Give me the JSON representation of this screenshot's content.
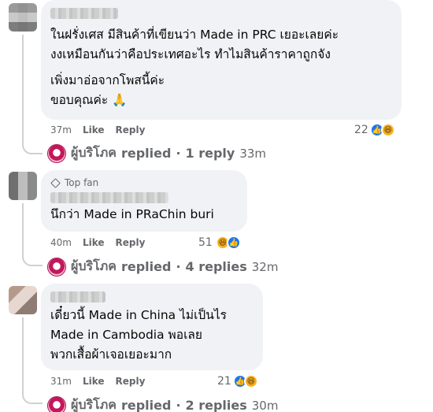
{
  "comments": [
    {
      "top_fan": "",
      "lines_a": [
        "ในฝรั่งเศส มีสินค้าที่เขียนว่า Made in PRC เยอะเลยค่ะ",
        "งงเหมือนกันว่าคือประเทศอะไร ทำไมสินค้าราคาถูกจัง"
      ],
      "lines_b": [
        "เพิ่งมาอ่อจากโพสนี้ค่ะ",
        "ขอบคุณค่ะ 🙏"
      ],
      "time": "37m",
      "like": "Like",
      "reply": "Reply",
      "reaction_count": "22",
      "replies_name": "ผู้บริโภค",
      "replies_text": "replied",
      "replies_count": "1 reply",
      "replies_time": "33m"
    },
    {
      "top_fan": "Top fan",
      "lines_a": [
        "นึกว่า Made in PRaChin buri"
      ],
      "time": "40m",
      "like": "Like",
      "reply": "Reply",
      "reaction_count": "51",
      "replies_name": "ผู้บริโภค",
      "replies_text": "replied",
      "replies_count": "4 replies",
      "replies_time": "32m"
    },
    {
      "top_fan": "",
      "lines_a": [
        "เดี๋ยวนี้ Made in China ไม่เป็นไร",
        "Made in Cambodia พอเลย",
        "พวกเสื้อผ้าเจอเยอะมาก"
      ],
      "time": "31m",
      "like": "Like",
      "reply": "Reply",
      "reaction_count": "21",
      "replies_name": "ผู้บริโภค",
      "replies_text": "replied",
      "replies_count": "2 replies",
      "replies_time": "30m"
    }
  ],
  "separator": "·",
  "icons": {
    "like": "like-icon",
    "haha": "haha-icon",
    "pray": "pray-emoji"
  },
  "colors": {
    "bubble": "#f0f2f5",
    "meta": "#65676b",
    "like_blue": "#1877f2",
    "haha_yellow": "#f7b125"
  }
}
